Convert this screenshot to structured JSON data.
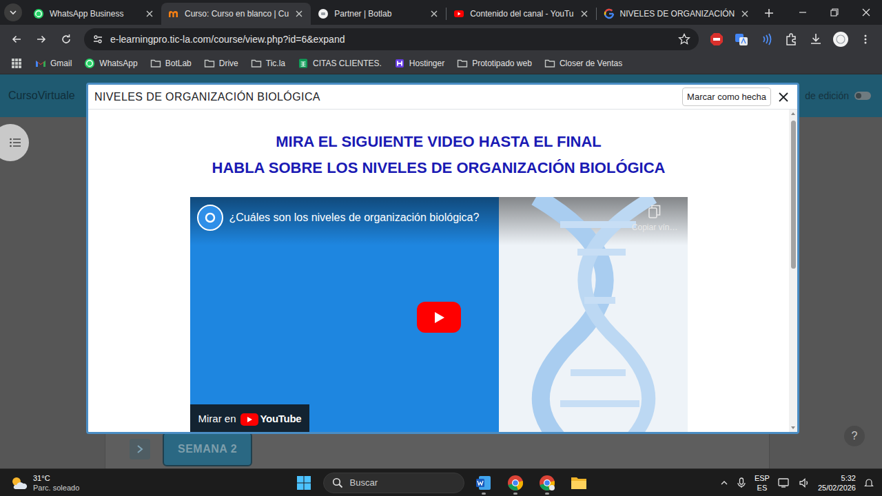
{
  "browser": {
    "tabs": [
      {
        "label": "WhatsApp Business",
        "selected": false,
        "kind": "whatsapp"
      },
      {
        "label": "Curso: Curso en blanco | Cu",
        "selected": true,
        "kind": "moodle"
      },
      {
        "label": "Partner | Botlab",
        "selected": false,
        "kind": "botlab"
      },
      {
        "label": "Contenido del canal - YouTu",
        "selected": false,
        "kind": "youtube"
      },
      {
        "label": "NIVELES DE ORGANIZACIÓN",
        "selected": false,
        "kind": "google"
      }
    ],
    "url": "e-learningpro.tic-la.com/course/view.php?id=6&expand",
    "bookmarks": [
      {
        "label": "Gmail",
        "kind": "gmail"
      },
      {
        "label": "WhatsApp",
        "kind": "whatsapp"
      },
      {
        "label": "BotLab",
        "kind": "folder"
      },
      {
        "label": "Drive",
        "kind": "folder"
      },
      {
        "label": "Tic.la",
        "kind": "folder"
      },
      {
        "label": "CITAS CLIENTES.",
        "kind": "sheet"
      },
      {
        "label": "Hostinger",
        "kind": "hostinger"
      },
      {
        "label": "Prototipado web",
        "kind": "folder"
      },
      {
        "label": "Closer de Ventas",
        "kind": "folder"
      }
    ]
  },
  "page": {
    "brand": "CursoVirtuale",
    "edit_mode": {
      "label": "de edición",
      "on": false
    },
    "section": "SEMANA 2",
    "help": "?"
  },
  "modal": {
    "title": "NIVELES DE ORGANIZACIÓN BIOLÓGICA",
    "done_button": "Marcar como hecha",
    "headings": [
      "MIRA EL SIGUIENTE VIDEO HASTA EL FINAL",
      "HABLA SOBRE LOS NIVELES DE ORGANIZACIÓN BIOLÓGICA"
    ],
    "video": {
      "title": "¿Cuáles son los niveles de organización biológica?",
      "copy_link": "Copiar vín…",
      "watch_on": "Mirar en",
      "youtube": "YouTube"
    }
  },
  "taskbar": {
    "weather": {
      "temp": "31°C",
      "desc": "Parc. soleado"
    },
    "search": "Buscar",
    "tray": {
      "lang": "ESP",
      "layout": "ES",
      "time": "5:32",
      "date": "25/02/2026"
    }
  }
}
